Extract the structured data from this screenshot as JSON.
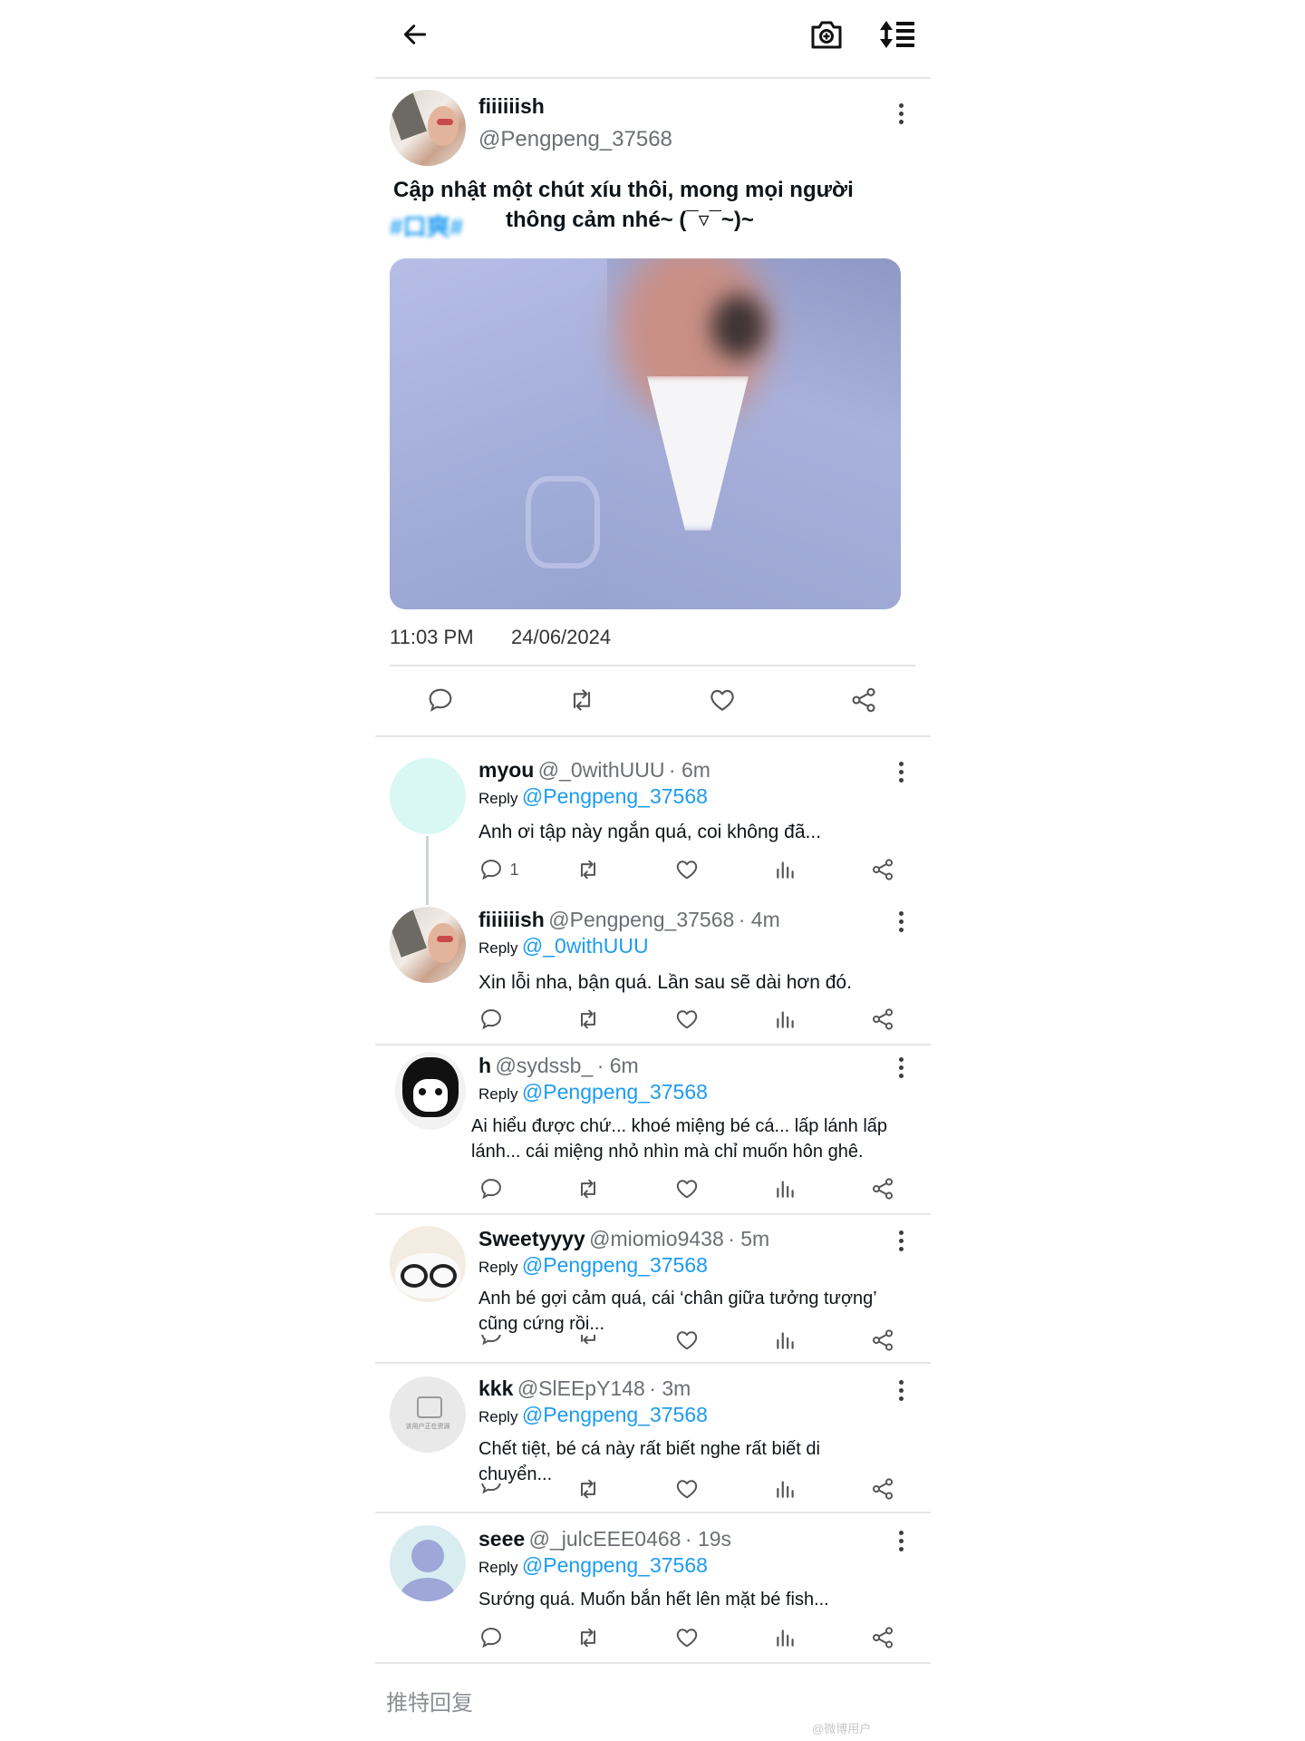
{
  "header": {
    "back_icon": "arrow-left-icon",
    "camera_icon": "camera-icon",
    "sort_icon": "sort-icon"
  },
  "post": {
    "name": "fiiiiiish",
    "handle": "@Pengpeng_37568",
    "text_line1": "Cập nhật một chút xíu thôi, mong mọi người",
    "hashtags": "#口爽#",
    "text_line2": "thông cảm nhé~ (¯▿¯~)~",
    "time": "11:03 PM",
    "date": "24/06/2024",
    "actions": [
      "comment-icon",
      "retweet-icon",
      "heart-icon",
      "share-icon"
    ]
  },
  "replies": [
    {
      "name": "myou",
      "handle": "@_0withUUU",
      "time": "· 6m",
      "reply_label": "Reply",
      "reply_to": "@Pengpeng_37568",
      "text": "Anh ơi tập này ngắn quá, coi không đã...",
      "comment_count": "1"
    },
    {
      "name": "fiiiiiish",
      "handle": "@Pengpeng_37568",
      "time": "· 4m",
      "reply_label": "Reply",
      "reply_to": "@_0withUUU",
      "text": "Xin lỗi nha, bận quá. Lần sau sẽ dài hơn đó."
    },
    {
      "name": "h",
      "handle": "@sydssb_",
      "time": "· 6m",
      "reply_label": "Reply",
      "reply_to": "@Pengpeng_37568",
      "text": "Ai hiểu được chứ... khoé miệng bé cá... lấp lánh lấp lánh... cái miệng nhỏ nhìn mà chỉ muốn hôn ghê."
    },
    {
      "name": "Sweetyyyy",
      "handle": "@miomio9438",
      "time": "· 5m",
      "reply_label": "Reply",
      "reply_to": "@Pengpeng_37568",
      "text": "Anh bé gợi cảm quá, cái ‘chân giữa tưởng tượng’ cũng cứng rồi..."
    },
    {
      "name": "kkk",
      "handle": "@SlEEpY148",
      "time": "· 3m",
      "reply_label": "Reply",
      "reply_to": "@Pengpeng_37568",
      "text": "Chết tiệt, bé cá này rất biết nghe rất biết di chuyển...",
      "avatar_text": "该用户正在资源"
    },
    {
      "name": "seee",
      "handle": "@_julcEEE0468",
      "time": "· 19s",
      "reply_label": "Reply",
      "reply_to": "@Pengpeng_37568",
      "text": "Sướng quá. Muốn bắn hết lên mặt bé fish..."
    }
  ],
  "footer": {
    "reply_placeholder": "推特回复",
    "watermark": "@微博用户"
  },
  "colors": {
    "accent": "#1d9bf0",
    "icon": "#6b6f74",
    "divider": "#e6e6e6"
  }
}
